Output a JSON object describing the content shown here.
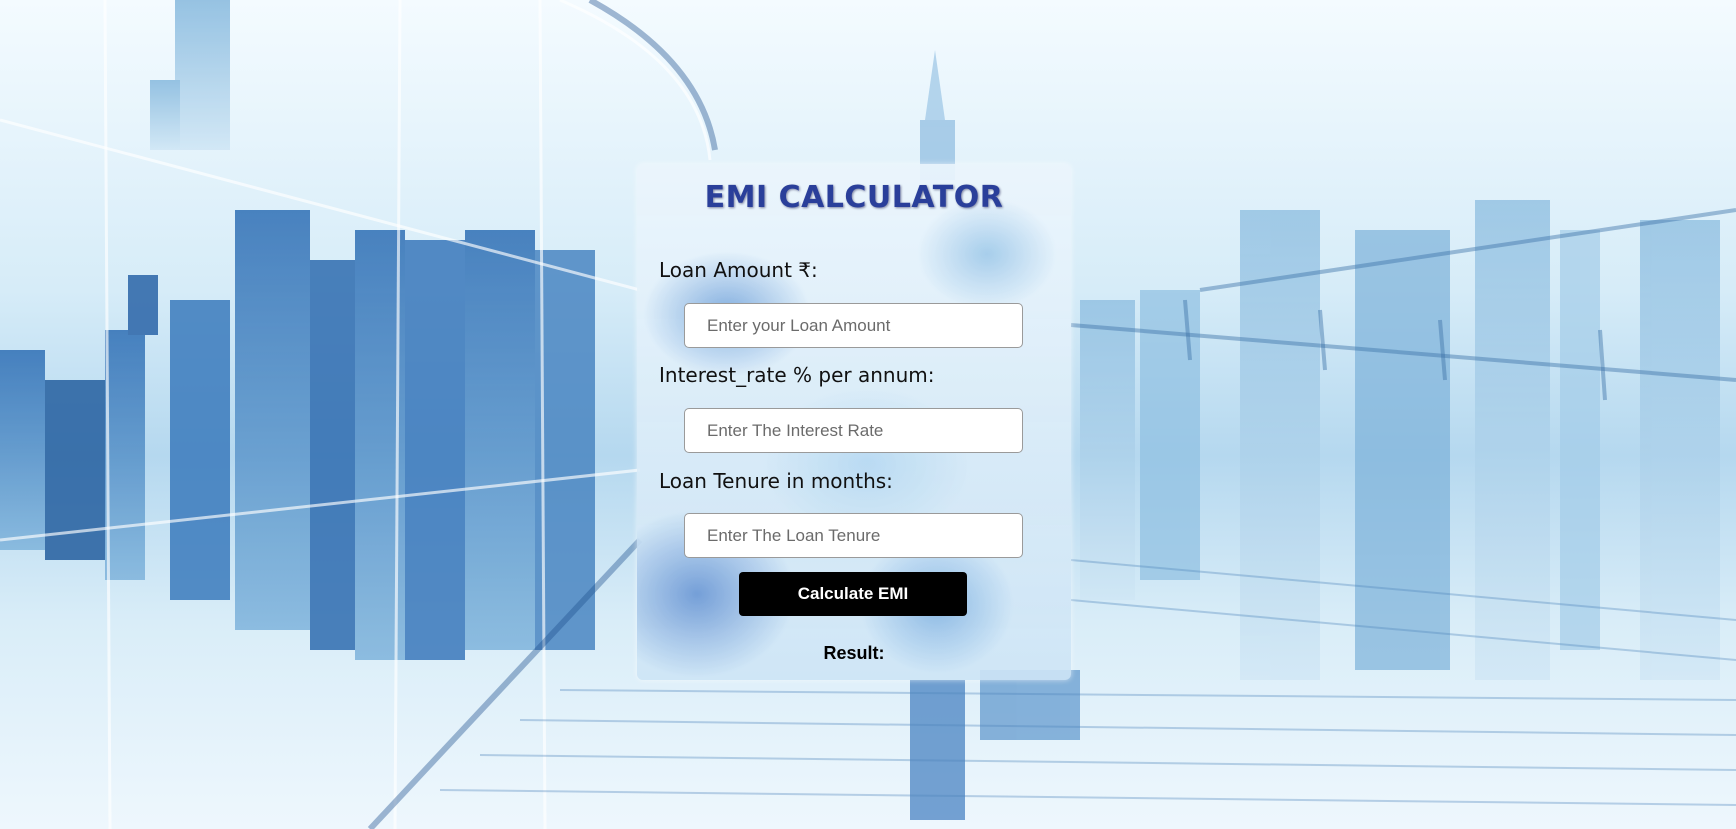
{
  "calculator": {
    "title": "EMI CALCULATOR",
    "loan_amount": {
      "label": "Loan Amount ₹:",
      "placeholder": "Enter your Loan Amount",
      "value": ""
    },
    "interest_rate": {
      "label": "Interest_rate % per annum:",
      "placeholder": "Enter The Interest Rate",
      "value": ""
    },
    "tenure": {
      "label": "Loan Tenure in months:",
      "placeholder": "Enter The Loan Tenure",
      "value": ""
    },
    "calculate_button": "Calculate EMI",
    "result_label": "Result:"
  },
  "colors": {
    "title": "#2a3f9a",
    "button_bg": "#000000",
    "button_text": "#ffffff"
  }
}
